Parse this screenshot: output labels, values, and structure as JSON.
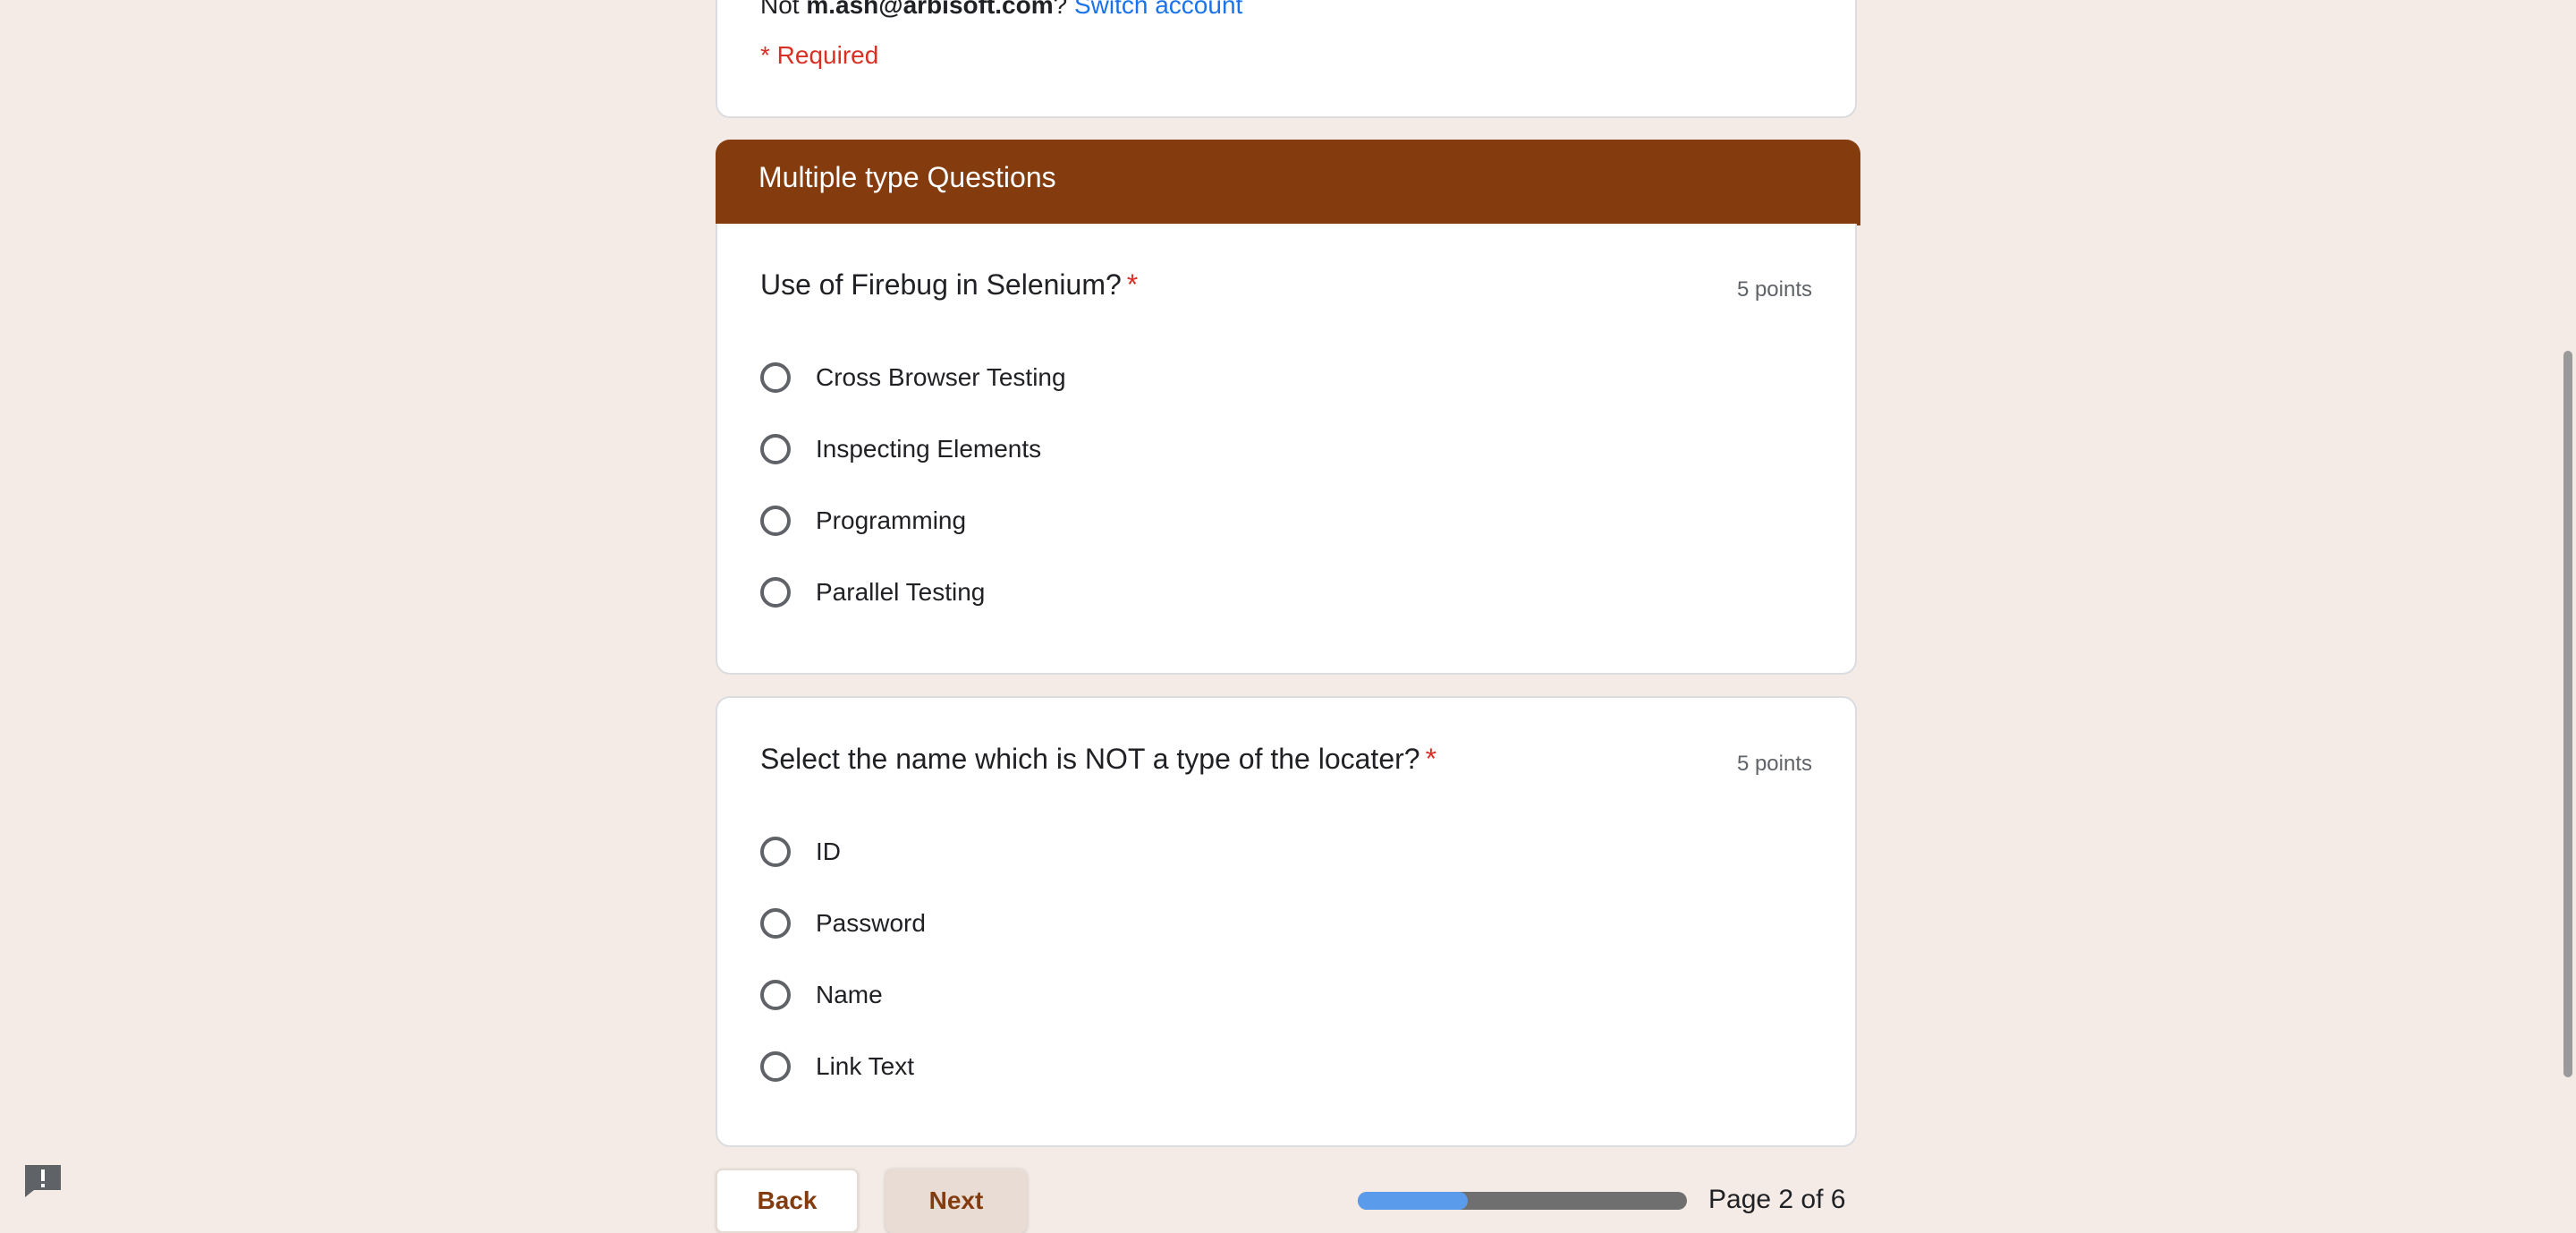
{
  "header": {
    "account_prefix": "Not ",
    "account_email": "m.ash@arbisoft.com",
    "account_suffix": "? ",
    "switch_account": "Switch account",
    "required_note": "* Required"
  },
  "section": {
    "title": "Multiple type Questions",
    "color": "#843c0f"
  },
  "questions": [
    {
      "title": "Use of Firebug in Selenium?",
      "required_mark": "*",
      "points": "5 points",
      "options": [
        "Cross Browser Testing",
        "Inspecting Elements",
        "Programming",
        "Parallel Testing"
      ]
    },
    {
      "title": "Select the name which is NOT a type of the locater?",
      "required_mark": "*",
      "points": "5 points",
      "options": [
        "ID",
        "Password",
        "Name",
        "Link Text"
      ]
    }
  ],
  "nav": {
    "back_label": "Back",
    "next_label": "Next",
    "progress_fraction": 0.333,
    "page_label": "Page 2 of 6"
  },
  "icons": {
    "feedback": "report-issue-icon"
  },
  "colors": {
    "background": "#f4ebe6",
    "accent": "#843c0f",
    "required": "#d93025",
    "link": "#1a73e8",
    "progress_fill": "#5b9bec"
  }
}
